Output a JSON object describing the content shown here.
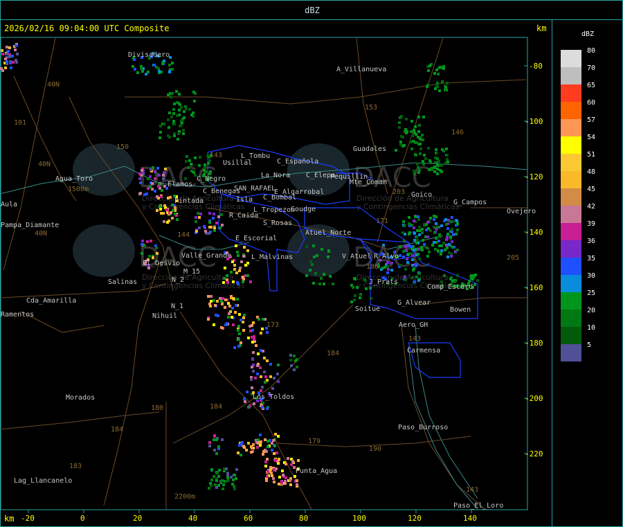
{
  "window": {
    "title": "dBZ"
  },
  "header": {
    "timestamp_label": "2026/02/16 09:04:00 UTC Composite",
    "km_top": "km",
    "km_bottom": "km"
  },
  "axes": {
    "x_ticks": [
      "-20",
      "0",
      "20",
      "40",
      "60",
      "80",
      "100",
      "120",
      "140"
    ],
    "y_ticks": [
      "-80",
      "-100",
      "-120",
      "-140",
      "-160",
      "-180",
      "-200",
      "-220"
    ]
  },
  "legend": {
    "title": "dBZ",
    "items": [
      {
        "value": "80",
        "color": "#dcdcdc"
      },
      {
        "value": "70",
        "color": "#bebebe"
      },
      {
        "value": "65",
        "color": "#ff3c1e"
      },
      {
        "value": "60",
        "color": "#ff6400"
      },
      {
        "value": "57",
        "color": "#ff9655"
      },
      {
        "value": "54",
        "color": "#ffff00"
      },
      {
        "value": "51",
        "color": "#fac832"
      },
      {
        "value": "48",
        "color": "#fab928"
      },
      {
        "value": "45",
        "color": "#d28c46"
      },
      {
        "value": "42",
        "color": "#c87896"
      },
      {
        "value": "39",
        "color": "#c81e96"
      },
      {
        "value": "36",
        "color": "#7828c8"
      },
      {
        "value": "35",
        "color": "#1e50ff"
      },
      {
        "value": "30",
        "color": "#0a8cdc"
      },
      {
        "value": "25",
        "color": "#00961e"
      },
      {
        "value": "20",
        "color": "#007814"
      },
      {
        "value": "10",
        "color": "#005a0a"
      },
      {
        "value": "5",
        "color": "#505096"
      }
    ]
  },
  "places": [
    {
      "name": "Divisadero"
    },
    {
      "name": "A_Villanueva"
    },
    {
      "name": "Guadales"
    },
    {
      "name": "L_Tombu"
    },
    {
      "name": "Usillal"
    },
    {
      "name": "C_Española"
    },
    {
      "name": "La_Nora"
    },
    {
      "name": "C_Elepa"
    },
    {
      "name": "Pequillin"
    },
    {
      "name": "Mte_Coman"
    },
    {
      "name": "Goico"
    },
    {
      "name": "G_Campos"
    },
    {
      "name": "Ovejero"
    },
    {
      "name": "Agua_Toro"
    },
    {
      "name": "Elamos"
    },
    {
      "name": "C_Negro"
    },
    {
      "name": "C_Benegas"
    },
    {
      "name": "SAN_RAFAEL"
    },
    {
      "name": "E_Algarrobal"
    },
    {
      "name": "C_Bombal"
    },
    {
      "name": "Pintada"
    },
    {
      "name": "Isla"
    },
    {
      "name": "L_Tropezon"
    },
    {
      "name": "Goudge"
    },
    {
      "name": "R_Caida"
    },
    {
      "name": "S_Rosas"
    },
    {
      "name": "Atuel_Norte"
    },
    {
      "name": "E_Escorial"
    },
    {
      "name": "Pampa_Diamante"
    },
    {
      "name": "Valle_Grande"
    },
    {
      "name": "L_Malvinas"
    },
    {
      "name": "V_Atuel"
    },
    {
      "name": "R_Alvo"
    },
    {
      "name": "El_Desvio"
    },
    {
      "name": "M_15"
    },
    {
      "name": "N_2"
    },
    {
      "name": "Salinas"
    },
    {
      "name": "J_Prats"
    },
    {
      "name": "Comp_Escard"
    },
    {
      "name": "Cda_Amarilla"
    },
    {
      "name": "Ramentos"
    },
    {
      "name": "N_1"
    },
    {
      "name": "Nihuil"
    },
    {
      "name": "Soitue"
    },
    {
      "name": "G_Alvear"
    },
    {
      "name": "Bowen"
    },
    {
      "name": "Aero_GH"
    },
    {
      "name": "Carmensa"
    },
    {
      "name": "Morados"
    },
    {
      "name": "Los_Toldos"
    },
    {
      "name": "Paso_Burroso"
    },
    {
      "name": "Punta_Agua"
    },
    {
      "name": "Lag_Llancanelo"
    },
    {
      "name": "Paso_El_Loro"
    },
    {
      "name": "Aula"
    }
  ],
  "routes": [
    "40N",
    "101",
    "40N",
    "150",
    "143",
    "40N",
    "144",
    "153",
    "146",
    "203",
    "171",
    "188",
    "205",
    "143",
    "173",
    "184",
    "184",
    "180",
    "184",
    "183",
    "179",
    "190",
    "143"
  ],
  "elevations": [
    "1500m",
    "2200m"
  ],
  "watermark": {
    "brand": "DACC",
    "line1": "Dirección de Agricultura",
    "line2": "y Contingencias Climáticas"
  }
}
